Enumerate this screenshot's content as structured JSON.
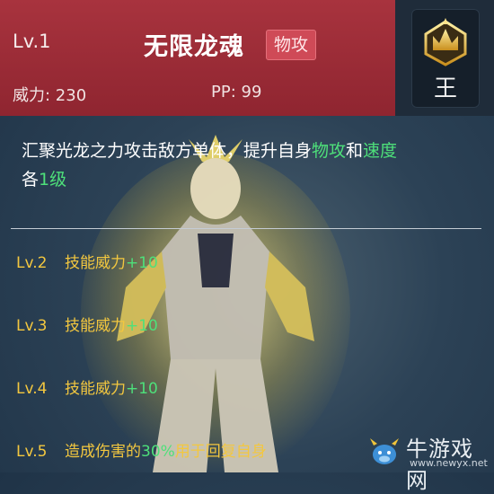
{
  "skill": {
    "level_label": "Lv.1",
    "name": "无限龙魂",
    "type_badge": "物攻",
    "power_label": "威力: 230",
    "pp_label": "PP: 99",
    "rank_label": "王"
  },
  "description": {
    "part1": "汇聚光龙之力攻击敌方单体，提升自身",
    "highlight1": "物攻",
    "part2": "和",
    "highlight2": "速度",
    "part3": "各",
    "highlight3": "1级"
  },
  "levels": [
    {
      "lv": "Lv.2",
      "text": "技能威力",
      "bonus": "+10",
      "suffix": ""
    },
    {
      "lv": "Lv.3",
      "text": "技能威力",
      "bonus": "+10",
      "suffix": ""
    },
    {
      "lv": "Lv.4",
      "text": "技能威力",
      "bonus": "+10",
      "suffix": ""
    },
    {
      "lv": "Lv.5",
      "text": "造成伤害的",
      "bonus": "30%",
      "suffix": "用于回复自身"
    }
  ],
  "watermark": {
    "name": "牛游戏网",
    "url": "www.newyx.net"
  },
  "colors": {
    "header_bg": "#a8333e",
    "accent_green": "#4ee07a",
    "level_gold": "#f3c73f"
  }
}
